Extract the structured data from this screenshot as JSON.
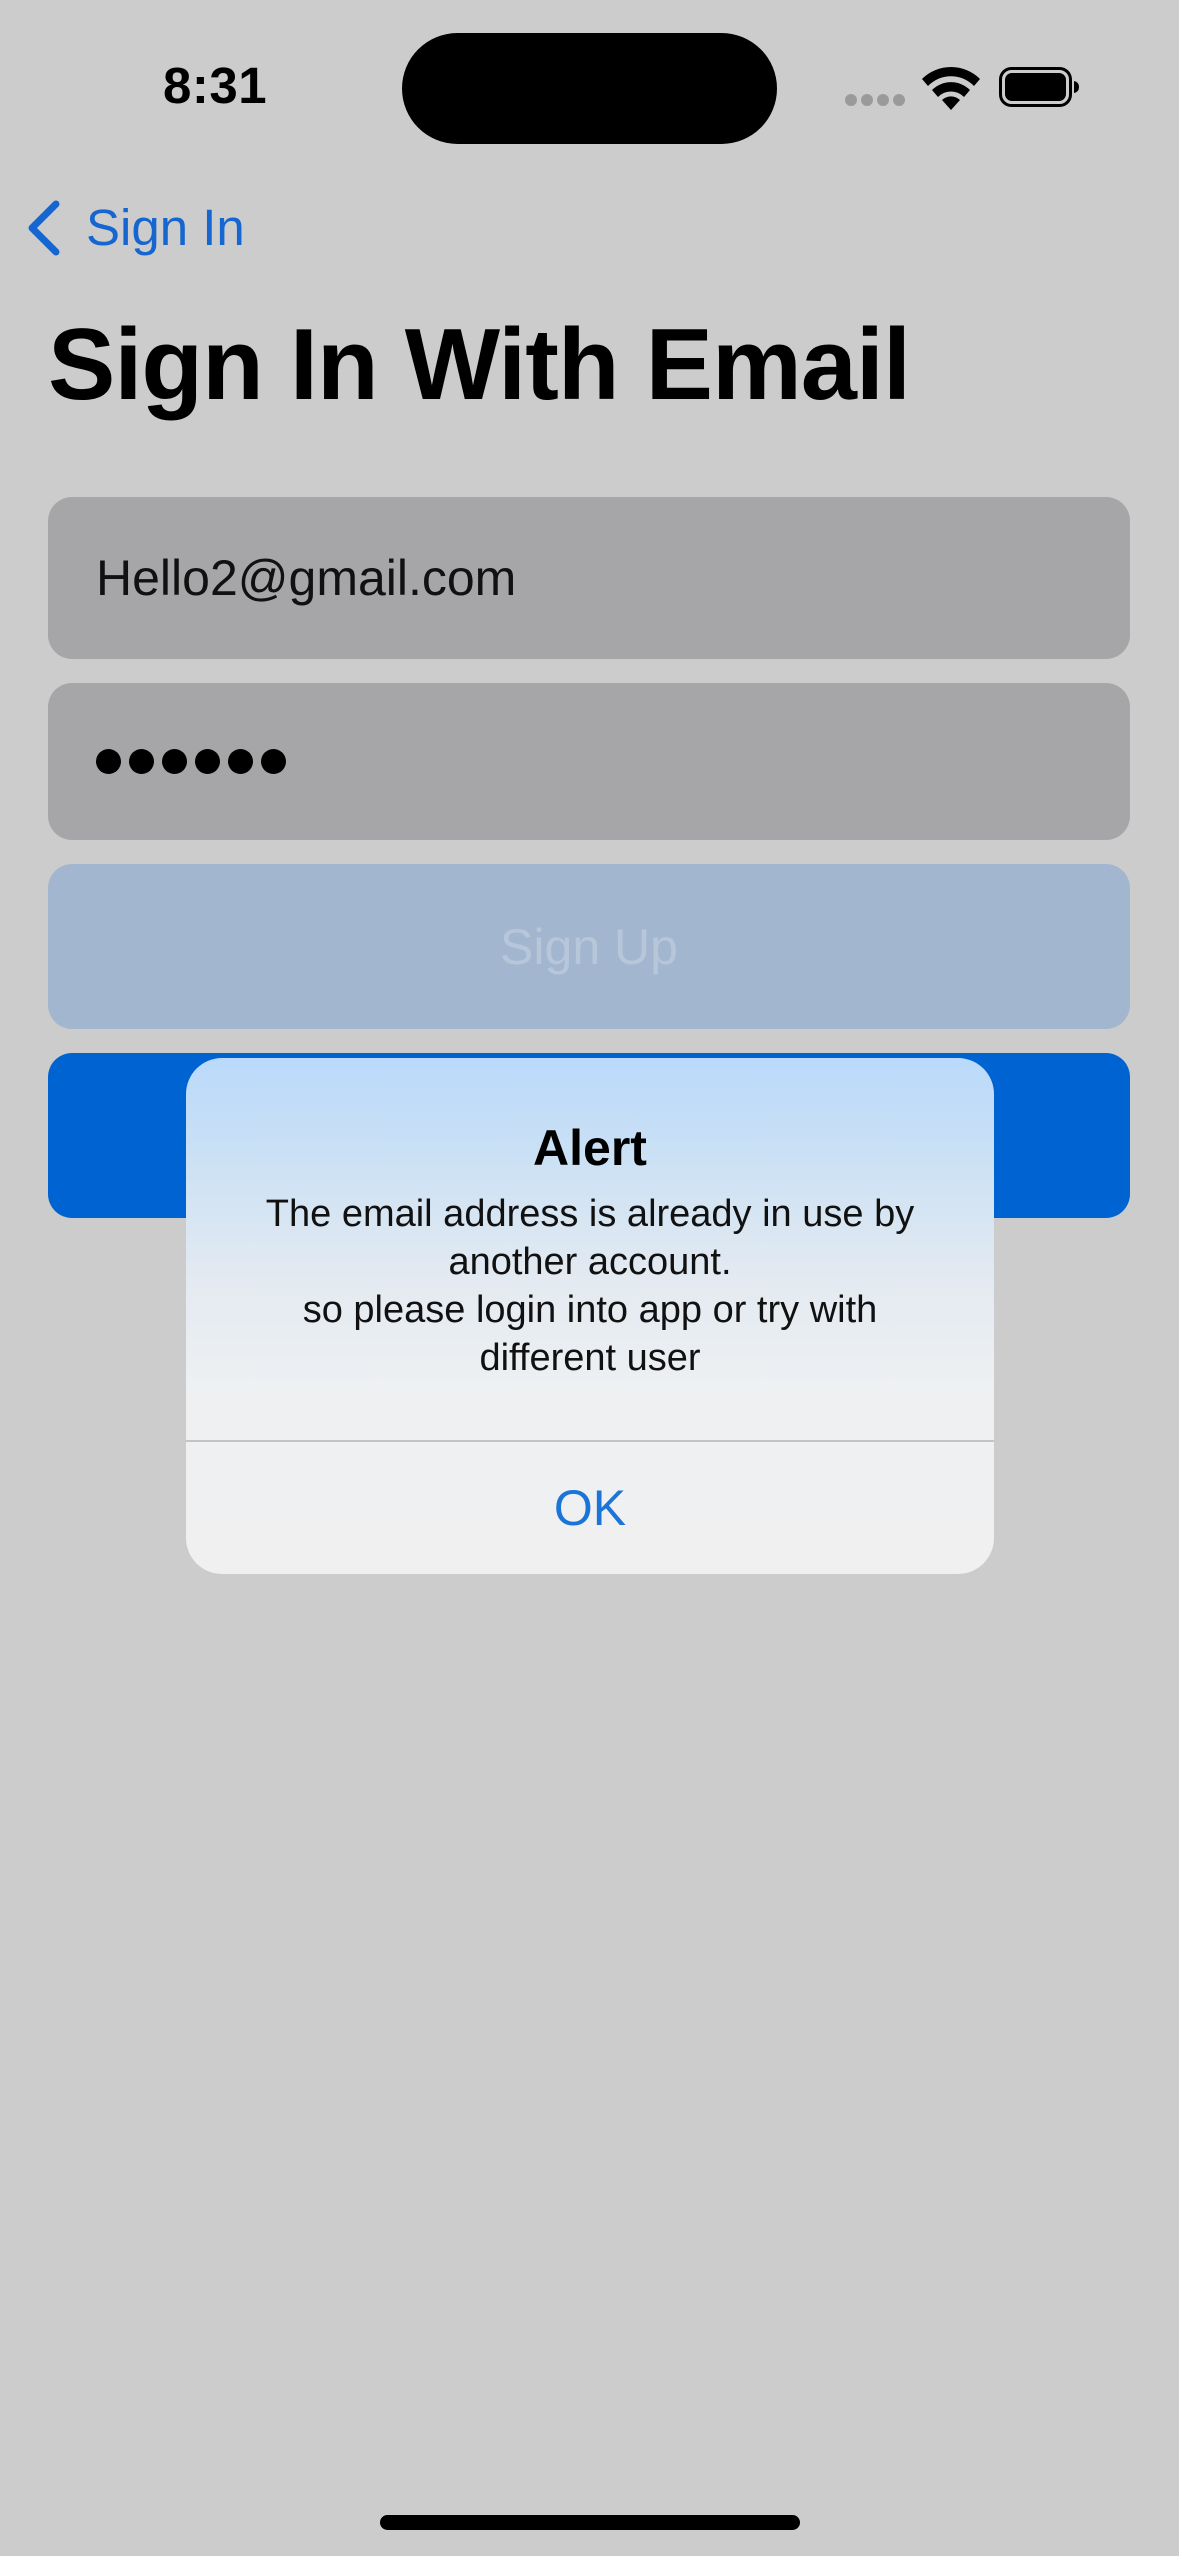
{
  "status_bar": {
    "time": "8:31",
    "icons": [
      "cellular-signal-icon",
      "wifi-icon",
      "battery-icon"
    ]
  },
  "nav": {
    "back_label": "Sign In",
    "back_icon": "chevron-left-icon"
  },
  "page": {
    "title": "Sign In With Email"
  },
  "form": {
    "email_value": "Hello2@gmail.com",
    "password_masked_length": 6,
    "signup_label": "Sign Up",
    "signin_label": ""
  },
  "alert": {
    "title": "Alert",
    "message_lines": [
      "The email address is already in use by",
      "another account.",
      "so please login into app or try with",
      "different user"
    ],
    "ok_label": "OK"
  },
  "colors": {
    "background": "#cccccc",
    "accent": "#1566d0",
    "primary_button": "#0063d2",
    "disabled_button": "#a3b6cf",
    "field": "#a6a6a8"
  }
}
